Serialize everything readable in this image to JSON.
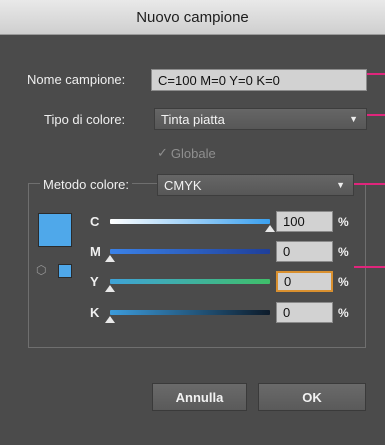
{
  "dialog": {
    "title": "Nuovo campione"
  },
  "name_field": {
    "label": "Nome campione:",
    "value": "C=100 M=0 Y=0 K=0"
  },
  "color_type": {
    "label": "Tipo di colore:",
    "value": "Tinta piatta"
  },
  "global_checkbox": {
    "label": "Globale",
    "checked": true,
    "enabled": false
  },
  "color_mode": {
    "label": "Metodo colore:",
    "value": "CMYK"
  },
  "swatch": {
    "color": "#4fa8ea"
  },
  "channels": [
    {
      "label": "C",
      "value": "100",
      "unit": "%",
      "level": 1.0,
      "color": "#7cc8ff"
    },
    {
      "label": "M",
      "value": "0",
      "unit": "%",
      "level": 0.0,
      "color": "#2f6fd8"
    },
    {
      "label": "Y",
      "value": "0",
      "unit": "%",
      "level": 0.0,
      "color": "#43c070"
    },
    {
      "label": "K",
      "value": "0",
      "unit": "%",
      "level": 0.0,
      "color": "#246aa8"
    }
  ],
  "buttons": {
    "cancel": "Annulla",
    "ok": "OK"
  },
  "annotation_color": "#e0257c"
}
